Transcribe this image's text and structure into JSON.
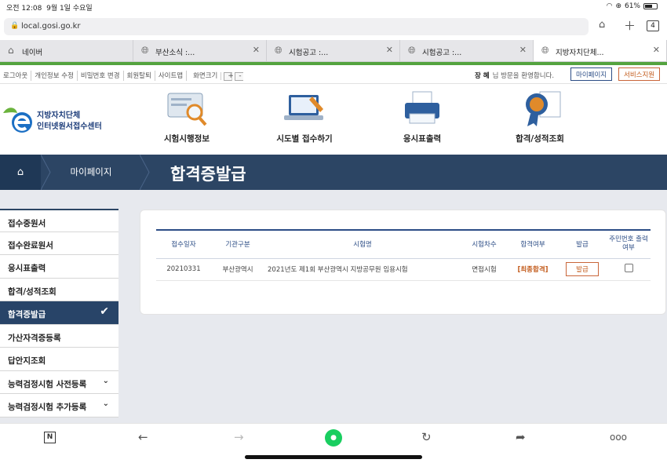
{
  "status": {
    "time": "오전 12:08",
    "date": "9월 1일 수요일",
    "battery": "61%"
  },
  "url": "local.gosi.go.kr",
  "tab_count": "4",
  "tabs": [
    {
      "label": "네이버",
      "icon": "home-icon"
    },
    {
      "label": "부산소식 :...",
      "icon": "globe-icon"
    },
    {
      "label": "시험공고 :...",
      "icon": "globe-icon"
    },
    {
      "label": "시험공고 :...",
      "icon": "globe-icon"
    },
    {
      "label": "지방자치단체...",
      "icon": "globe-icon"
    }
  ],
  "util": {
    "links": [
      "로그아웃",
      "개인정보 수정",
      "비밀번호 변경",
      "회원탈퇴",
      "사이트맵",
      "화면크기"
    ],
    "zoom_plus": "+",
    "zoom_minus": "-",
    "user_name": "장  혜",
    "welcome": "님 방문을 환영합니다.",
    "mypage": "마이페이지",
    "service": "서비스지원"
  },
  "logo": {
    "line1": "지방자치단체",
    "line2": "인터넷원서접수센터"
  },
  "menu": [
    "시험시행정보",
    "시도별 접수하기",
    "응시표출력",
    "합격/성적조회"
  ],
  "breadcrumb": {
    "crumb": "마이페이지",
    "title": "합격증발급"
  },
  "sidebar": [
    {
      "label": "접수중원서"
    },
    {
      "label": "접수완료원서"
    },
    {
      "label": "응시표출력"
    },
    {
      "label": "합격/성적조회"
    },
    {
      "label": "합격증발급",
      "active": true
    },
    {
      "label": "가산자격증등록"
    },
    {
      "label": "답안지조회"
    },
    {
      "label": "능력검정시험 사전등록",
      "expand": true
    },
    {
      "label": "능력검정시험 추가등록",
      "expand": true
    }
  ],
  "table": {
    "headers": [
      "접수일자",
      "기관구분",
      "시험명",
      "시험차수",
      "합격여부",
      "발급",
      "주민번호 출력여부"
    ],
    "rows": [
      {
        "date": "20210331",
        "agency": "부산광역시",
        "name": "2021년도 제1회 부산광역시 지방공무원 임용시험",
        "round": "면접시험",
        "result": "[최종합격]",
        "issue": "발급"
      }
    ]
  },
  "colors": {
    "nav": "#2c4564",
    "accent_green": "#54a33f",
    "pass": "#c25a1a"
  }
}
